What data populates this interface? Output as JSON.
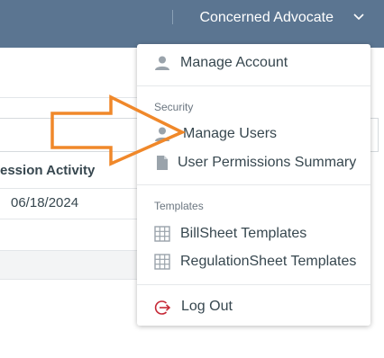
{
  "header": {
    "user_name": "Concerned Advocate",
    "icons": {
      "dropdown": "chevron-down-icon"
    }
  },
  "table": {
    "columns": [
      "ession Activity"
    ],
    "rows": [
      [
        "06/18/2024"
      ]
    ]
  },
  "menu": {
    "manage_account": "Manage Account",
    "security_title": "Security",
    "manage_users": "Manage Users",
    "user_permissions": "User Permissions Summary",
    "templates_title": "Templates",
    "billsheet_templates": "BillSheet Templates",
    "regulationsheet_templates": "RegulationSheet Templates",
    "log_out": "Log Out",
    "icons": {
      "account": "person-icon",
      "users": "person-icon",
      "permissions": "document-icon",
      "billsheet": "grid-icon",
      "regulationsheet": "grid-icon",
      "logout": "logout-icon"
    }
  },
  "colors": {
    "header_bg": "#5b7591",
    "arrow": "#f0882a",
    "logout_icon": "#c62836",
    "icon_grey": "#9aa3ab"
  }
}
